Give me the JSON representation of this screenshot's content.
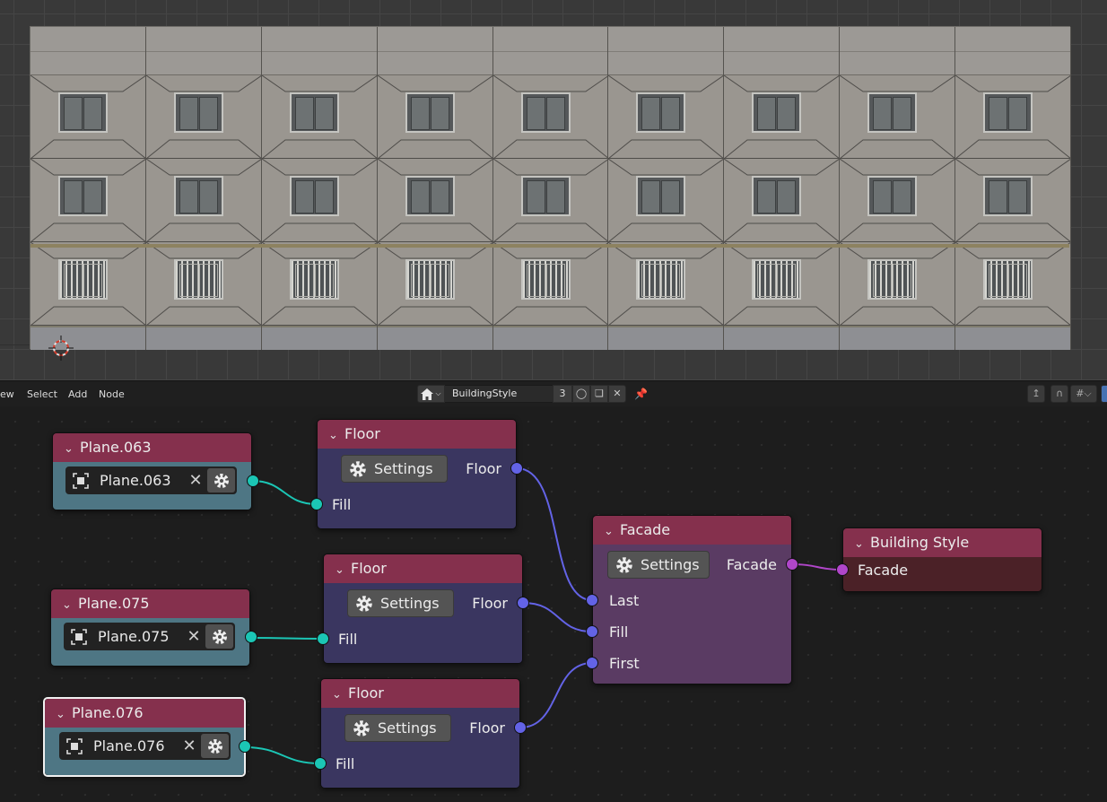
{
  "viewport": {
    "facade_modules": 9,
    "texture_colors": {
      "wall": "#9a9690",
      "window_frame": "#c4c4c0",
      "ground": "#8e8f93"
    }
  },
  "header": {
    "menu": [
      "ew",
      "Select",
      "Add",
      "Node"
    ],
    "tree_name": "BuildingStyle",
    "users": "3"
  },
  "nodes": {
    "plane063": {
      "title": "Plane.063",
      "object": "Plane.063"
    },
    "plane075": {
      "title": "Plane.075",
      "object": "Plane.075"
    },
    "plane076": {
      "title": "Plane.076",
      "object": "Plane.076"
    },
    "floor1": {
      "title": "Floor",
      "settings": "Settings",
      "output": "Floor",
      "input": "Fill"
    },
    "floor2": {
      "title": "Floor",
      "settings": "Settings",
      "output": "Floor",
      "input": "Fill"
    },
    "floor3": {
      "title": "Floor",
      "settings": "Settings",
      "output": "Floor",
      "input": "Fill"
    },
    "facade": {
      "title": "Facade",
      "settings": "Settings",
      "output": "Facade",
      "inputs": [
        "Last",
        "Fill",
        "First"
      ]
    },
    "building_style": {
      "title": "Building Style",
      "input": "Facade"
    }
  },
  "colors": {
    "header": "#85304d",
    "object_socket": "#1bc6b5",
    "floor_socket": "#6363e6",
    "facade_socket": "#b046c9",
    "object_body": "#4e7684",
    "floor_body": "#3a3660",
    "facade_body": "#5a3b63"
  }
}
